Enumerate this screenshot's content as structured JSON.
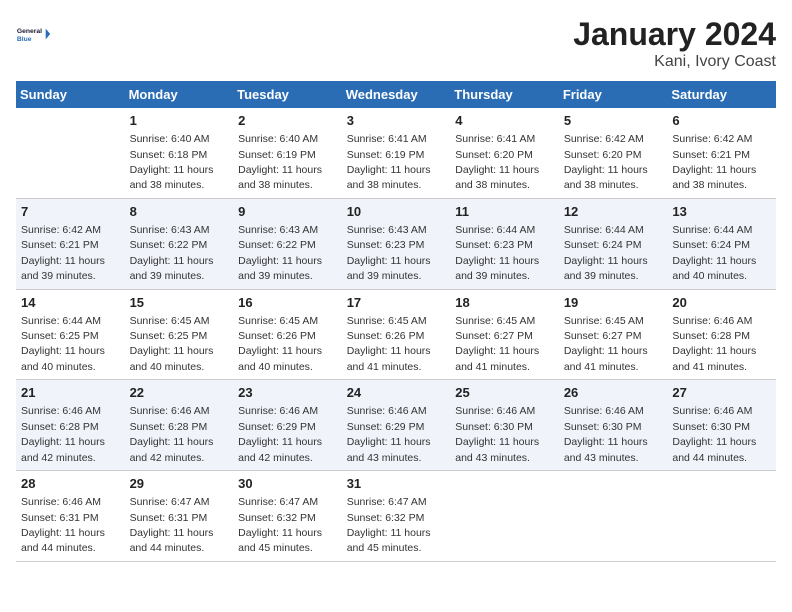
{
  "logo": {
    "line1": "General",
    "line2": "Blue"
  },
  "title": "January 2024",
  "subtitle": "Kani, Ivory Coast",
  "weekdays": [
    "Sunday",
    "Monday",
    "Tuesday",
    "Wednesday",
    "Thursday",
    "Friday",
    "Saturday"
  ],
  "weeks": [
    [
      {
        "num": "",
        "sunrise": "",
        "sunset": "",
        "daylight": ""
      },
      {
        "num": "1",
        "sunrise": "Sunrise: 6:40 AM",
        "sunset": "Sunset: 6:18 PM",
        "daylight": "Daylight: 11 hours and 38 minutes."
      },
      {
        "num": "2",
        "sunrise": "Sunrise: 6:40 AM",
        "sunset": "Sunset: 6:19 PM",
        "daylight": "Daylight: 11 hours and 38 minutes."
      },
      {
        "num": "3",
        "sunrise": "Sunrise: 6:41 AM",
        "sunset": "Sunset: 6:19 PM",
        "daylight": "Daylight: 11 hours and 38 minutes."
      },
      {
        "num": "4",
        "sunrise": "Sunrise: 6:41 AM",
        "sunset": "Sunset: 6:20 PM",
        "daylight": "Daylight: 11 hours and 38 minutes."
      },
      {
        "num": "5",
        "sunrise": "Sunrise: 6:42 AM",
        "sunset": "Sunset: 6:20 PM",
        "daylight": "Daylight: 11 hours and 38 minutes."
      },
      {
        "num": "6",
        "sunrise": "Sunrise: 6:42 AM",
        "sunset": "Sunset: 6:21 PM",
        "daylight": "Daylight: 11 hours and 38 minutes."
      }
    ],
    [
      {
        "num": "7",
        "sunrise": "Sunrise: 6:42 AM",
        "sunset": "Sunset: 6:21 PM",
        "daylight": "Daylight: 11 hours and 39 minutes."
      },
      {
        "num": "8",
        "sunrise": "Sunrise: 6:43 AM",
        "sunset": "Sunset: 6:22 PM",
        "daylight": "Daylight: 11 hours and 39 minutes."
      },
      {
        "num": "9",
        "sunrise": "Sunrise: 6:43 AM",
        "sunset": "Sunset: 6:22 PM",
        "daylight": "Daylight: 11 hours and 39 minutes."
      },
      {
        "num": "10",
        "sunrise": "Sunrise: 6:43 AM",
        "sunset": "Sunset: 6:23 PM",
        "daylight": "Daylight: 11 hours and 39 minutes."
      },
      {
        "num": "11",
        "sunrise": "Sunrise: 6:44 AM",
        "sunset": "Sunset: 6:23 PM",
        "daylight": "Daylight: 11 hours and 39 minutes."
      },
      {
        "num": "12",
        "sunrise": "Sunrise: 6:44 AM",
        "sunset": "Sunset: 6:24 PM",
        "daylight": "Daylight: 11 hours and 39 minutes."
      },
      {
        "num": "13",
        "sunrise": "Sunrise: 6:44 AM",
        "sunset": "Sunset: 6:24 PM",
        "daylight": "Daylight: 11 hours and 40 minutes."
      }
    ],
    [
      {
        "num": "14",
        "sunrise": "Sunrise: 6:44 AM",
        "sunset": "Sunset: 6:25 PM",
        "daylight": "Daylight: 11 hours and 40 minutes."
      },
      {
        "num": "15",
        "sunrise": "Sunrise: 6:45 AM",
        "sunset": "Sunset: 6:25 PM",
        "daylight": "Daylight: 11 hours and 40 minutes."
      },
      {
        "num": "16",
        "sunrise": "Sunrise: 6:45 AM",
        "sunset": "Sunset: 6:26 PM",
        "daylight": "Daylight: 11 hours and 40 minutes."
      },
      {
        "num": "17",
        "sunrise": "Sunrise: 6:45 AM",
        "sunset": "Sunset: 6:26 PM",
        "daylight": "Daylight: 11 hours and 41 minutes."
      },
      {
        "num": "18",
        "sunrise": "Sunrise: 6:45 AM",
        "sunset": "Sunset: 6:27 PM",
        "daylight": "Daylight: 11 hours and 41 minutes."
      },
      {
        "num": "19",
        "sunrise": "Sunrise: 6:45 AM",
        "sunset": "Sunset: 6:27 PM",
        "daylight": "Daylight: 11 hours and 41 minutes."
      },
      {
        "num": "20",
        "sunrise": "Sunrise: 6:46 AM",
        "sunset": "Sunset: 6:28 PM",
        "daylight": "Daylight: 11 hours and 41 minutes."
      }
    ],
    [
      {
        "num": "21",
        "sunrise": "Sunrise: 6:46 AM",
        "sunset": "Sunset: 6:28 PM",
        "daylight": "Daylight: 11 hours and 42 minutes."
      },
      {
        "num": "22",
        "sunrise": "Sunrise: 6:46 AM",
        "sunset": "Sunset: 6:28 PM",
        "daylight": "Daylight: 11 hours and 42 minutes."
      },
      {
        "num": "23",
        "sunrise": "Sunrise: 6:46 AM",
        "sunset": "Sunset: 6:29 PM",
        "daylight": "Daylight: 11 hours and 42 minutes."
      },
      {
        "num": "24",
        "sunrise": "Sunrise: 6:46 AM",
        "sunset": "Sunset: 6:29 PM",
        "daylight": "Daylight: 11 hours and 43 minutes."
      },
      {
        "num": "25",
        "sunrise": "Sunrise: 6:46 AM",
        "sunset": "Sunset: 6:30 PM",
        "daylight": "Daylight: 11 hours and 43 minutes."
      },
      {
        "num": "26",
        "sunrise": "Sunrise: 6:46 AM",
        "sunset": "Sunset: 6:30 PM",
        "daylight": "Daylight: 11 hours and 43 minutes."
      },
      {
        "num": "27",
        "sunrise": "Sunrise: 6:46 AM",
        "sunset": "Sunset: 6:30 PM",
        "daylight": "Daylight: 11 hours and 44 minutes."
      }
    ],
    [
      {
        "num": "28",
        "sunrise": "Sunrise: 6:46 AM",
        "sunset": "Sunset: 6:31 PM",
        "daylight": "Daylight: 11 hours and 44 minutes."
      },
      {
        "num": "29",
        "sunrise": "Sunrise: 6:47 AM",
        "sunset": "Sunset: 6:31 PM",
        "daylight": "Daylight: 11 hours and 44 minutes."
      },
      {
        "num": "30",
        "sunrise": "Sunrise: 6:47 AM",
        "sunset": "Sunset: 6:32 PM",
        "daylight": "Daylight: 11 hours and 45 minutes."
      },
      {
        "num": "31",
        "sunrise": "Sunrise: 6:47 AM",
        "sunset": "Sunset: 6:32 PM",
        "daylight": "Daylight: 11 hours and 45 minutes."
      },
      {
        "num": "",
        "sunrise": "",
        "sunset": "",
        "daylight": ""
      },
      {
        "num": "",
        "sunrise": "",
        "sunset": "",
        "daylight": ""
      },
      {
        "num": "",
        "sunrise": "",
        "sunset": "",
        "daylight": ""
      }
    ]
  ]
}
